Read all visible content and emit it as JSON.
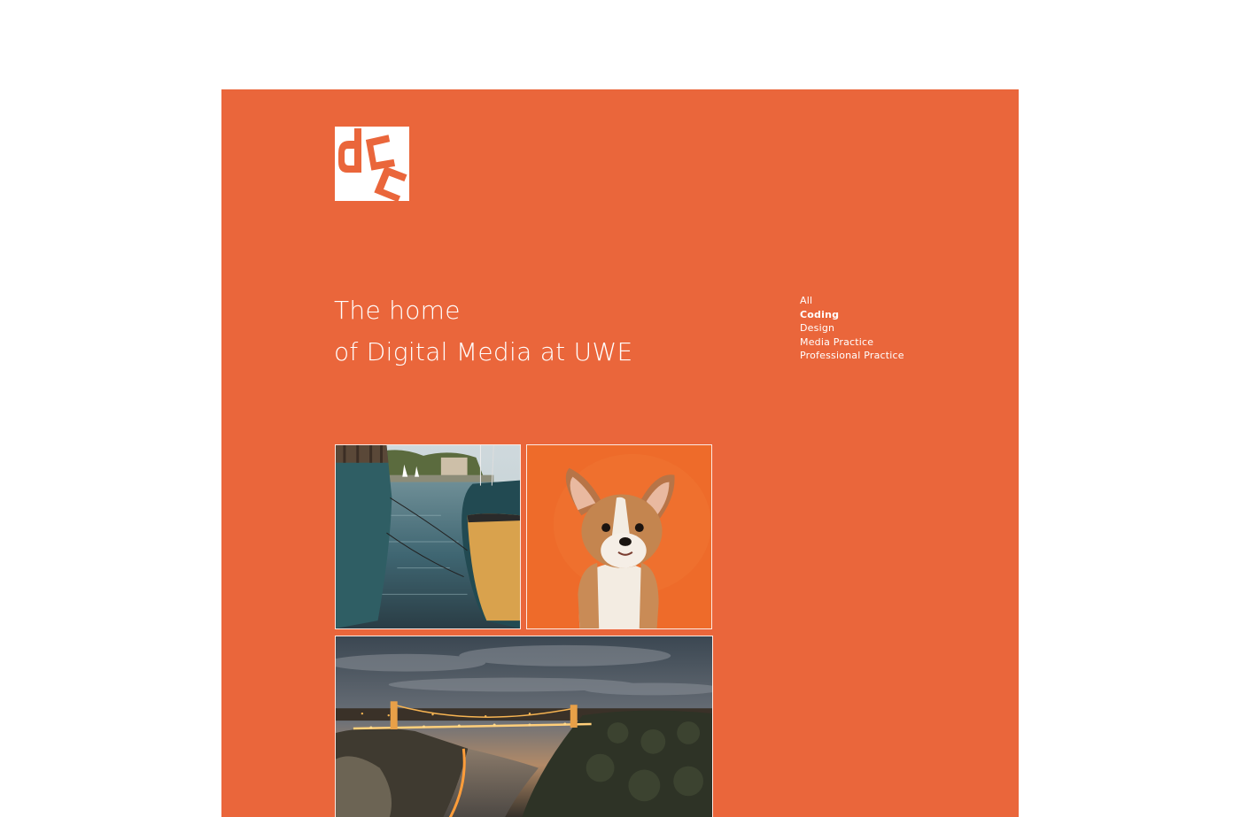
{
  "logo": {
    "icon": "dcc-logo-icon"
  },
  "hero": {
    "headline_line1": "The home",
    "headline_line2": "of Digital Media at UWE"
  },
  "filters": {
    "items": [
      {
        "label": "All",
        "active": false
      },
      {
        "label": "Coding",
        "active": true
      },
      {
        "label": "Design",
        "active": false
      },
      {
        "label": "Media Practice",
        "active": false
      },
      {
        "label": "Professional Practice",
        "active": false
      }
    ]
  },
  "colors": {
    "brand_orange": "#ea663b",
    "text": "#ffffff",
    "background": "#ffffff"
  },
  "gallery": {
    "tiles": [
      {
        "name": "harbour-boats-photo"
      },
      {
        "name": "corgi-puppy-photo"
      },
      {
        "name": "suspension-bridge-photo"
      }
    ]
  }
}
